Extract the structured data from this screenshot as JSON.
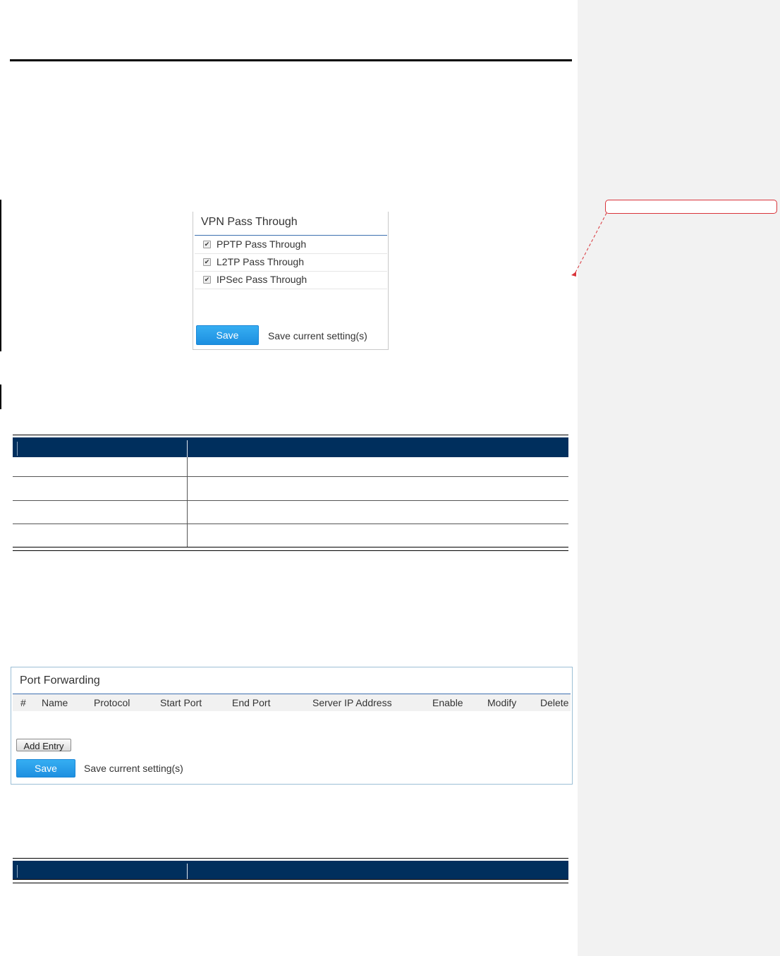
{
  "vpn_panel": {
    "title": "VPN Pass Through",
    "items": [
      {
        "label": "PPTP Pass Through",
        "checked": true
      },
      {
        "label": "L2TP Pass Through",
        "checked": true
      },
      {
        "label": "IPSec Pass Through",
        "checked": true
      }
    ],
    "save_label": "Save",
    "save_hint": "Save current setting(s)"
  },
  "port_forwarding": {
    "title": "Port Forwarding",
    "columns": [
      "#",
      "Name",
      "Protocol",
      "Start Port",
      "End Port",
      "Server IP Address",
      "Enable",
      "Modify",
      "Delete"
    ],
    "add_entry_label": "Add Entry",
    "save_label": "Save",
    "save_hint": "Save current setting(s)"
  },
  "colors": {
    "table_header": "#002f5d",
    "save_button": "#1d8fe0",
    "comment_border": "#d9343a",
    "comment_pane": "#f2f2f2"
  },
  "icons": {
    "checkbox": "checkmark-icon"
  }
}
